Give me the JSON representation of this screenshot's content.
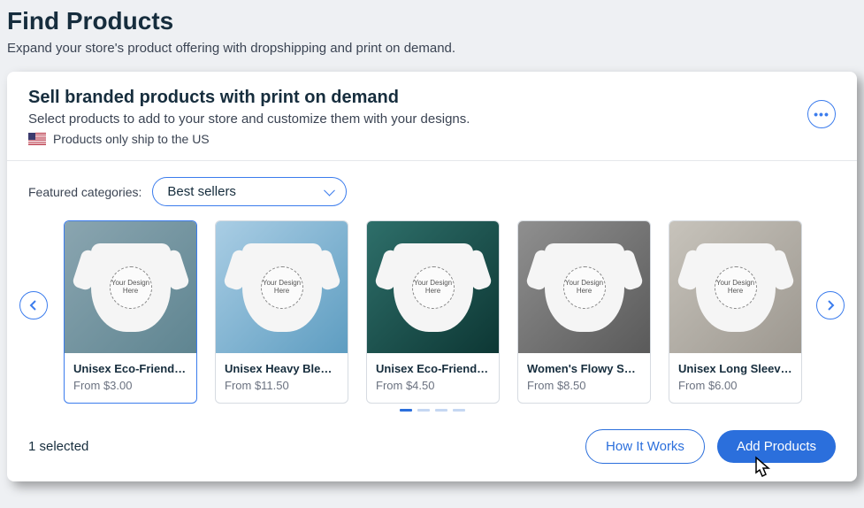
{
  "page": {
    "title": "Find Products",
    "subtitle": "Expand your store's product offering with dropshipping and print on demand."
  },
  "card": {
    "title": "Sell branded products with print on demand",
    "subtitle": "Select products to add to your store and customize them with your designs.",
    "ship_notice": "Products only ship to the US"
  },
  "filters": {
    "label": "Featured categories:",
    "selected": "Best sellers"
  },
  "design_placeholder": "Your\nDesign\nHere",
  "products": [
    {
      "name": "Unisex Eco-Friendly He...",
      "price": "From $3.00",
      "selected": true
    },
    {
      "name": "Unisex Heavy Blend H...",
      "price": "From $11.50",
      "selected": false
    },
    {
      "name": "Unisex Eco-Friendly Co...",
      "price": "From $4.50",
      "selected": false
    },
    {
      "name": "Women's Flowy Scoop ...",
      "price": "From $8.50",
      "selected": false
    },
    {
      "name": "Unisex Long Sleeve T-...",
      "price": "From $6.00",
      "selected": false
    }
  ],
  "pagination": {
    "total": 4,
    "active": 0
  },
  "footer": {
    "selected_text": "1 selected",
    "how_it_works": "How It Works",
    "add_products": "Add Products"
  }
}
